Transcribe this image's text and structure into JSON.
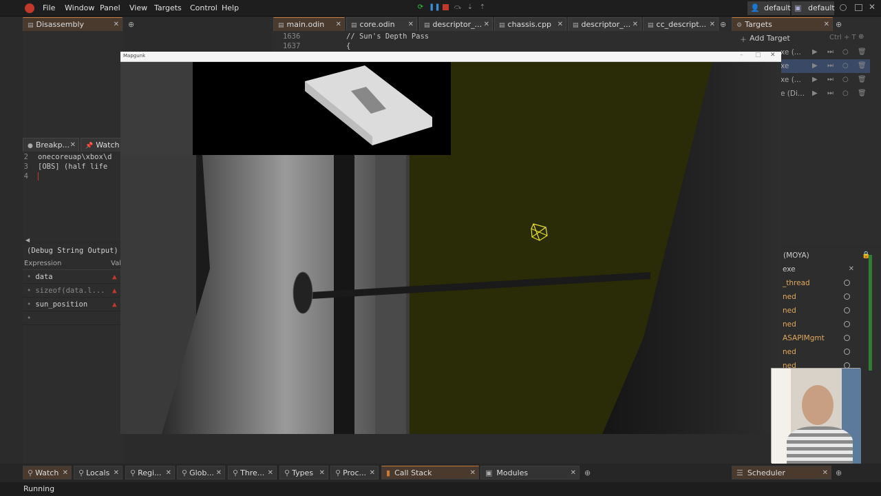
{
  "menu": [
    "File",
    "Window",
    "Panel",
    "View",
    "Targets",
    "Control",
    "Help"
  ],
  "user": {
    "label1": "default",
    "label2": "default"
  },
  "left_top_tab": "Disassembly",
  "editor_tabs": [
    {
      "label": "main.odin"
    },
    {
      "label": "core.odin"
    },
    {
      "label": "descriptor_..."
    },
    {
      "label": "chassis.cpp"
    },
    {
      "label": "descriptor_..."
    },
    {
      "label": "cc_descript..."
    }
  ],
  "code": [
    {
      "ln": "1636",
      "text": "// Sun's Depth Pass"
    },
    {
      "ln": "1637",
      "text": "{"
    }
  ],
  "game_window": {
    "title": "Mapgunk"
  },
  "targets_tab": "Targets",
  "add_target": {
    "label": "Add Target",
    "shortcut": "Ctrl + T"
  },
  "targets": [
    {
      "label": "xe (..."
    },
    {
      "label": "xe"
    },
    {
      "label": "xe (..."
    },
    {
      "label": "e (Di..."
    }
  ],
  "breakpoints_tab": "Breakp...",
  "watch_small_tab": "Watch ...",
  "output_lines": [
    {
      "ln": "2",
      "text": "onecoreuap\\xbox\\d"
    },
    {
      "ln": "3",
      "text": "[OBS] (half life"
    },
    {
      "ln": "4",
      "text": ""
    }
  ],
  "debug_output_label": "(Debug String Output)",
  "watch_columns": {
    "expression": "Expression",
    "value": "Val"
  },
  "watch_rows": [
    {
      "expr": "data",
      "error": true
    },
    {
      "expr": "sizeof(data.l...",
      "error": true
    },
    {
      "expr": "sun_position",
      "error": true
    },
    {
      "expr": "",
      "error": false
    }
  ],
  "threads_header": "(MOYA)",
  "threads": [
    {
      "label": "exe"
    },
    {
      "label": "_thread"
    },
    {
      "label": "ned"
    },
    {
      "label": "ned"
    },
    {
      "label": "ned"
    },
    {
      "label": "ASAPIMgmt"
    },
    {
      "label": "ned"
    },
    {
      "label": "ned"
    }
  ],
  "bottom_tabs": [
    {
      "label": "Watch"
    },
    {
      "label": "Locals"
    },
    {
      "label": "Regi..."
    },
    {
      "label": "Glob..."
    },
    {
      "label": "Thre..."
    },
    {
      "label": "Types"
    },
    {
      "label": "Proc..."
    },
    {
      "label": "Call Stack"
    },
    {
      "label": "Modules"
    },
    {
      "label": "Scheduler"
    }
  ],
  "status": "Running",
  "colors": {
    "accent": "#c77b3a",
    "error": "#c0392b",
    "wire": "#e8e02a"
  }
}
